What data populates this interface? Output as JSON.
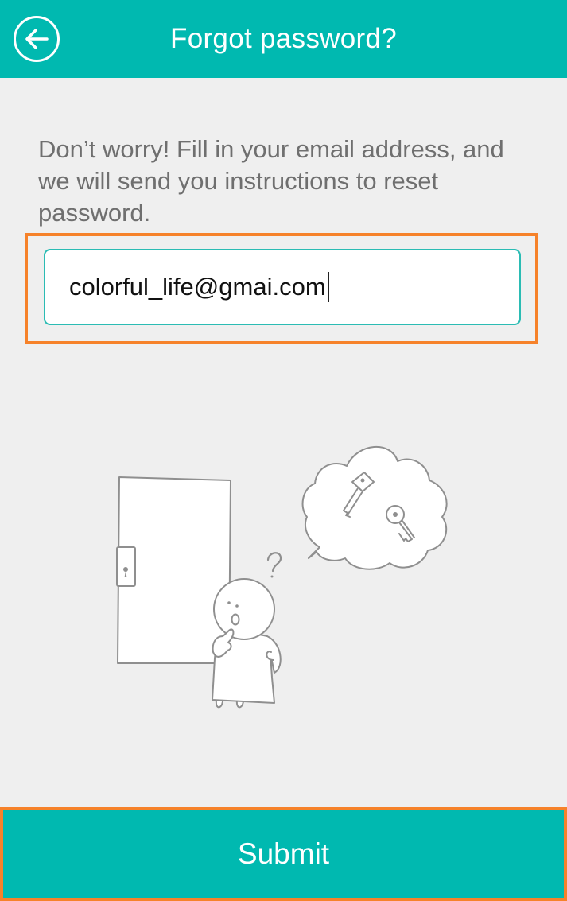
{
  "header": {
    "title": "Forgot password?",
    "back_icon": "arrow-left-circle-icon",
    "background_color": "#00b9b0"
  },
  "main": {
    "instructions": "Don’t worry! Fill in your email address, and we will send you instructions to reset password.",
    "email_input": {
      "value": "colorful_life@gmai.com"
    },
    "illustration_icon": "door-person-keys-illustration"
  },
  "footer": {
    "submit_label": "Submit"
  },
  "colors": {
    "accent": "#00b9b0",
    "highlight": "#f6822a",
    "text_secondary": "#6f6f6f"
  }
}
